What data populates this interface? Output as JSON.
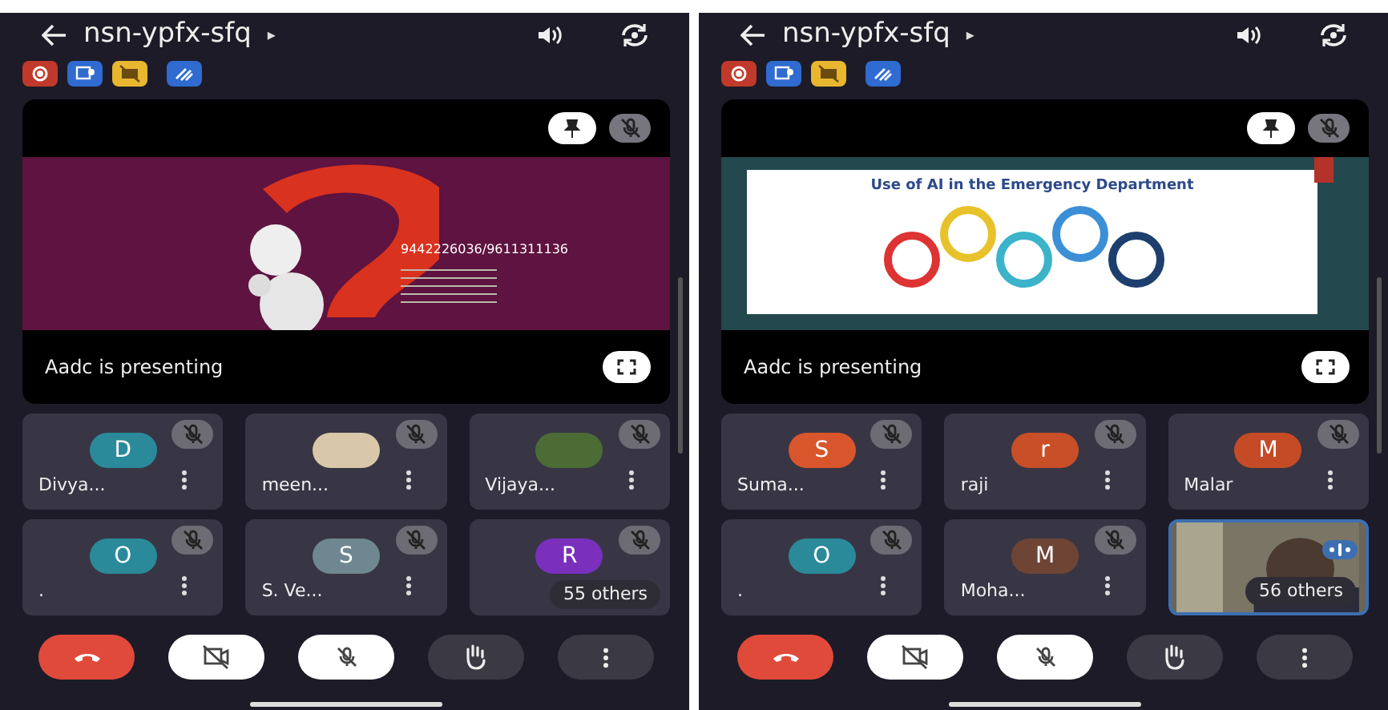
{
  "screens": [
    {
      "title": "nsn-ypfx-sfq",
      "title_caret": "▸",
      "presentation": {
        "kind": "question",
        "phone": "9442226036/9611311136",
        "caption": "Aadc is presenting"
      },
      "tiles": [
        {
          "kind": "letter",
          "initial": "D",
          "color": "#2a8a9a",
          "name": "Divya...",
          "muted": true
        },
        {
          "kind": "photo",
          "name": "meen...",
          "muted": true
        },
        {
          "kind": "photo",
          "name": "Vijaya...",
          "muted": true
        },
        {
          "kind": "letter",
          "initial": "O",
          "color": "#2a8a9a",
          "name": ".",
          "muted": true
        },
        {
          "kind": "letter",
          "initial": "S",
          "color": "#6f8790",
          "name": "S. Ve...",
          "muted": true
        },
        {
          "kind": "letter",
          "initial": "R",
          "color": "#7a2fbd",
          "others": "55 others",
          "muted": true
        }
      ]
    },
    {
      "title": "nsn-ypfx-sfq",
      "title_caret": "▸",
      "presentation": {
        "kind": "diagram",
        "slide_title": "Use of AI in the Emergency Department",
        "caption": "Aadc is presenting"
      },
      "tiles": [
        {
          "kind": "letter",
          "initial": "S",
          "color": "#d9552b",
          "name": "Suma...",
          "muted": true
        },
        {
          "kind": "letter",
          "initial": "r",
          "color": "#c94f28",
          "name": "raji",
          "muted": true
        },
        {
          "kind": "letter",
          "initial": "M",
          "color": "#c44b26",
          "name": "Malar",
          "muted": true
        },
        {
          "kind": "letter",
          "initial": "O",
          "color": "#2a8a9a",
          "name": ".",
          "muted": true
        },
        {
          "kind": "letter",
          "initial": "M",
          "color": "#6e4535",
          "name": "Moha...",
          "muted": true
        },
        {
          "kind": "video",
          "others": "56 others"
        }
      ]
    }
  ]
}
